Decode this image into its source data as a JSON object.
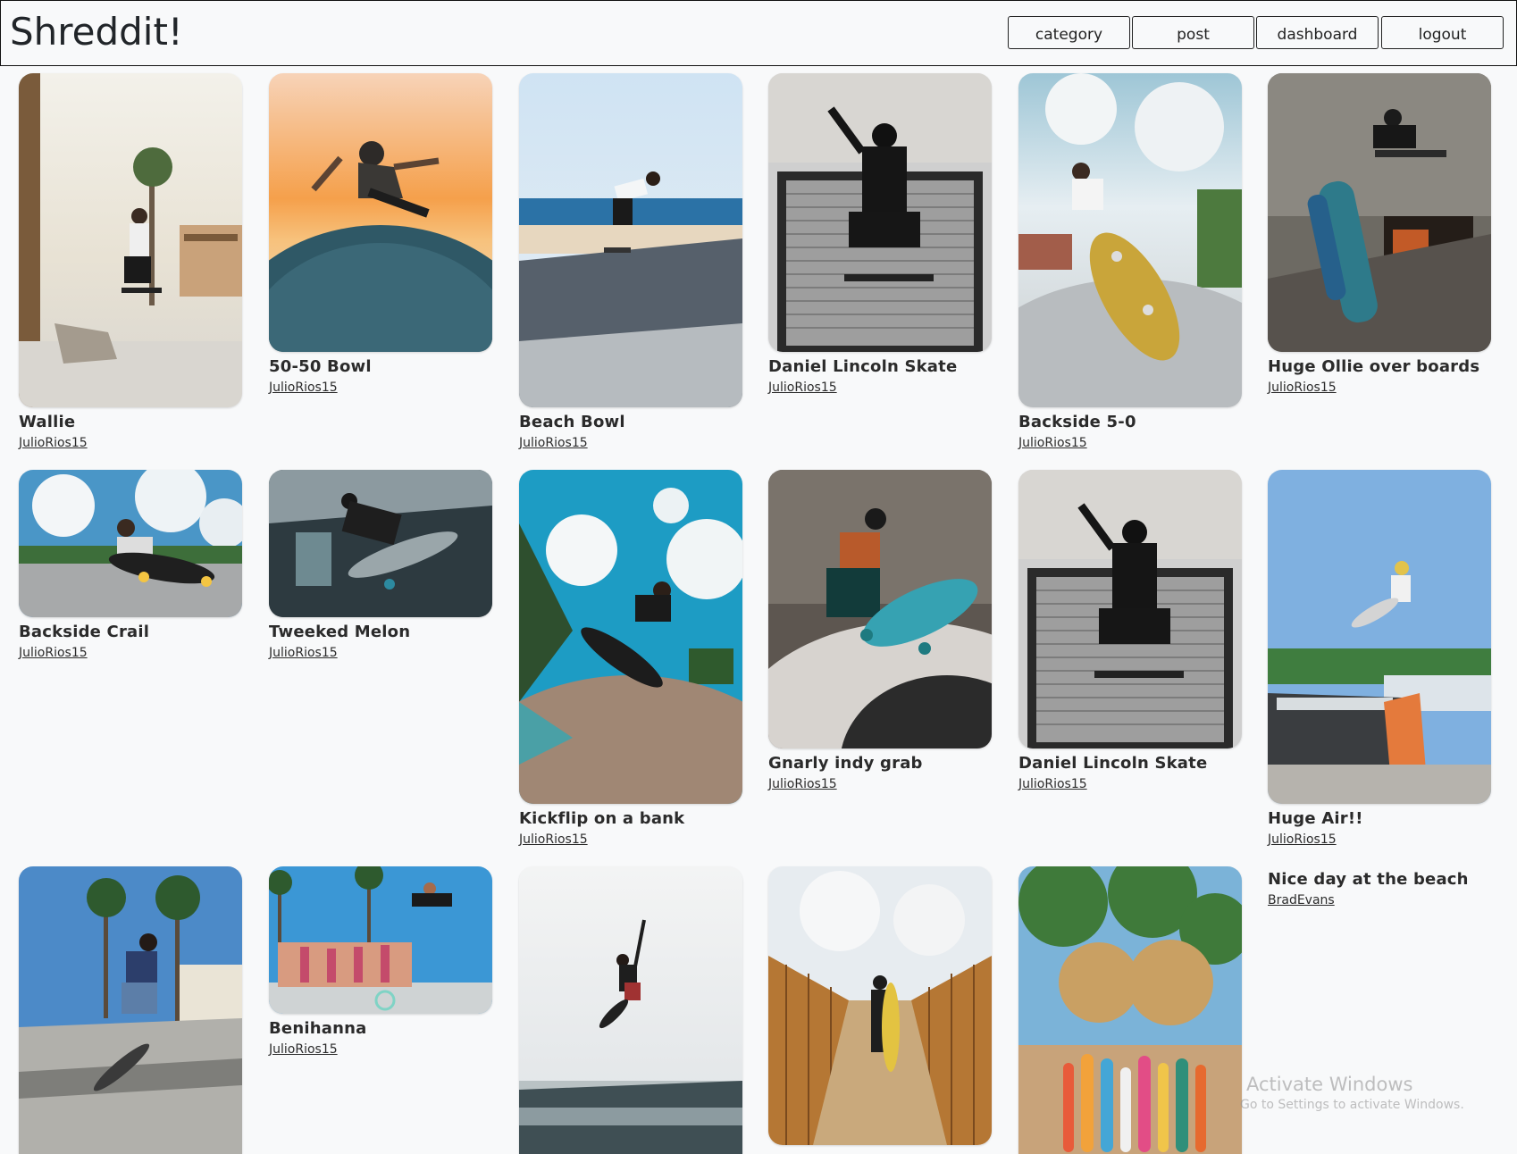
{
  "app": {
    "brand": "Shreddit!"
  },
  "nav": {
    "category_label": "category",
    "post_label": "post",
    "dashboard_label": "dashboard",
    "logout_label": "logout"
  },
  "posts": [
    {
      "title": "Wallie",
      "user": "JulioRios15",
      "photo": "skater-palm-boardwalk"
    },
    {
      "title": "50-50 Bowl",
      "user": "JulioRios15",
      "photo": "skater-bowl-sunset"
    },
    {
      "title": "Beach Bowl",
      "user": "JulioRios15",
      "photo": "skater-bowl-ocean"
    },
    {
      "title": "Daniel Lincoln Skate",
      "user": "JulioRios15",
      "photo": "skater-garage-door"
    },
    {
      "title": "Backside 5-0",
      "user": "JulioRios15",
      "photo": "skater-grind-sky"
    },
    {
      "title": "Huge Ollie over boards",
      "user": "JulioRios15",
      "photo": "skater-ollie-boards"
    },
    {
      "title": "Backside Crail",
      "user": "JulioRios15",
      "photo": "skater-crail-clouds"
    },
    {
      "title": "Tweeked Melon",
      "user": "JulioRios15",
      "photo": "skater-indoor-melon"
    },
    {
      "title": "Kickflip on a bank",
      "user": "JulioRios15",
      "photo": "skater-kickflip-bank"
    },
    {
      "title": "Gnarly indy grab",
      "user": "JulioRios15",
      "photo": "skater-indy-grab"
    },
    {
      "title": "Daniel Lincoln Skate",
      "user": "JulioRios15",
      "photo": "skater-garage-door"
    },
    {
      "title": "Huge Air!!",
      "user": "JulioRios15",
      "photo": "skater-huge-air"
    },
    {
      "title": "",
      "user": "",
      "photo": "skater-stairs-palms"
    },
    {
      "title": "Benihanna",
      "user": "JulioRios15",
      "photo": "skater-crowd-beach"
    },
    {
      "title": "",
      "user": "",
      "photo": "skater-jump-sky"
    },
    {
      "title": "",
      "user": "",
      "photo": "surfer-fence-path"
    },
    {
      "title": "",
      "user": "",
      "photo": "surfboards-palms"
    },
    {
      "title": "Nice day at the beach",
      "user": "BradEvans",
      "photo": ""
    }
  ],
  "watermark": {
    "line1": "Activate Windows",
    "line2": "Go to Settings to activate Windows."
  },
  "colors": {
    "page_bg": "#f8f9fa",
    "text": "#212529",
    "nav_border": "#111111"
  }
}
